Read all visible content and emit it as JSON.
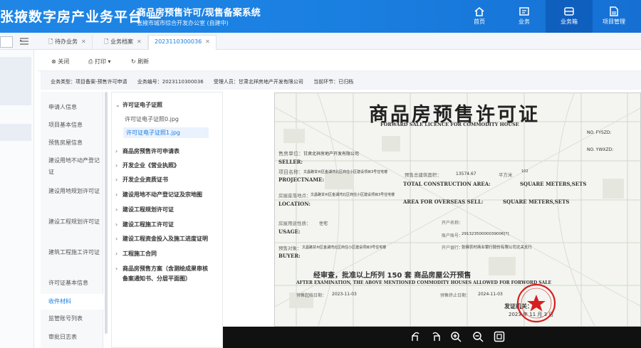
{
  "header": {
    "title": "张掖数字房产业务平台 —",
    "system": "商品房预售许可/现售备案系统",
    "org": "张掖市城市综合开发办公室 (自建中)"
  },
  "nav": [
    {
      "label": "首页",
      "icon": "home-icon"
    },
    {
      "label": "业务",
      "icon": "business-icon"
    },
    {
      "label": "业务箱",
      "icon": "inbox-icon"
    },
    {
      "label": "项目管理",
      "icon": "project-icon"
    }
  ],
  "tabs": [
    {
      "label": "待办业务"
    },
    {
      "label": "业务档案"
    },
    {
      "label": "2023110300036"
    }
  ],
  "toolbar": {
    "close": "关闭",
    "print": "打印",
    "refresh": "刷新"
  },
  "info": {
    "type": "业务类型：项目备案-预售许可申请",
    "number": "业务编号：2023110300036",
    "applicant": "受理人员：甘肃北祥房地产开发有限公司",
    "stage": "当前环节：已归档"
  },
  "menu": [
    "申请人信息",
    "项目基本信息",
    "预售房屋信息",
    "建设用地不动产登记证",
    "建设用地规划许可证",
    "建设工程规划许可证",
    "建筑工程施工许可证",
    "许可证基本信息",
    "收件材料",
    "监管账号列表",
    "审批日志表"
  ],
  "tree": {
    "root": "许可证电子证照",
    "leaves": [
      "许可证电子证照0.jpg",
      "许可证电子证照1.jpg"
    ],
    "nodes": [
      "商品房预售许可申请表",
      "开发企业《营业执照》",
      "开发企业资质证书",
      "建设用地不动产登记证及宗地图",
      "建设工程规划许可证",
      "建设工程施工许可证",
      "建设工程资金投入及施工进度证明",
      "工程施工合同",
      "商品房预售方案（含测绘成果审核",
      "备案通知书、分层平面图）"
    ]
  },
  "doc": {
    "title": "商品房预售许可证",
    "subtitle": "FORWARD SALE LICENCE FOR COMMODITY HOUSE",
    "no1": "NO. FYSZD:",
    "no2": "NO. YWXZD:",
    "seller_cn": "售房单位：",
    "seller_val": "甘肃北祥房地产开发有限公司",
    "seller_en": "SELLER:",
    "project_cn": "项目名称：",
    "project_val": "文昌路甘州区金湖湾北区商住小区建设项目3号住宅楼",
    "project_en": "PROJECTNAME:",
    "area_cn": "预售总建筑面积：",
    "area_val": "13574.67",
    "area_unit": "平方米",
    "sets": "102",
    "area_en1": "TOTAL CONSTRUCTION AREA:",
    "area_en2": "SQUARE METERS,SETS",
    "loc_cn": "房屋座落地点：",
    "loc_val": "文昌路甘州区金湖湾北区商住小区建设项目3号住宅楼",
    "loc_en": "LOCATION:",
    "overseas": "AREA FOR OVERSEAS SELL:",
    "overseas_unit": "SQUARE METERS,SETS",
    "usage_cn": "房屋用途性质：",
    "usage_val": "住宅",
    "usage_en": "USAGE:",
    "bank_name": "开户名称：",
    "account": "账户账号：",
    "account_val": "29132350000039006[?]",
    "bank": "开户银行：",
    "bank_val": "张掖农村商业银行股份有限公司北关支行",
    "buyer_cn": "预售对象：",
    "buyer_val": "文昌路甘州区金湖湾北区商住小区建设项目3号住宅楼",
    "buyer_en": "BUYER:",
    "approve": "经审查，批准以上所列 150    套    商品房屋公开预售",
    "approve_en": "AFTER EXAMINATION, THE ABOVE MENTIONED    COMMODITY HOUSES ALLOWED FOR FORWORD SALE",
    "start": "预售起始日期：",
    "start_val": "2023-11-03",
    "end": "预售终止日期：",
    "end_val": "2024-11-03",
    "issuer": "发证机关：",
    "date": "2023  年  11  月  3  日",
    "seal": "张掖市城市综合开发办公室"
  },
  "colors": {
    "brand": "#1a7fe0",
    "seal": "#d61f1f"
  }
}
